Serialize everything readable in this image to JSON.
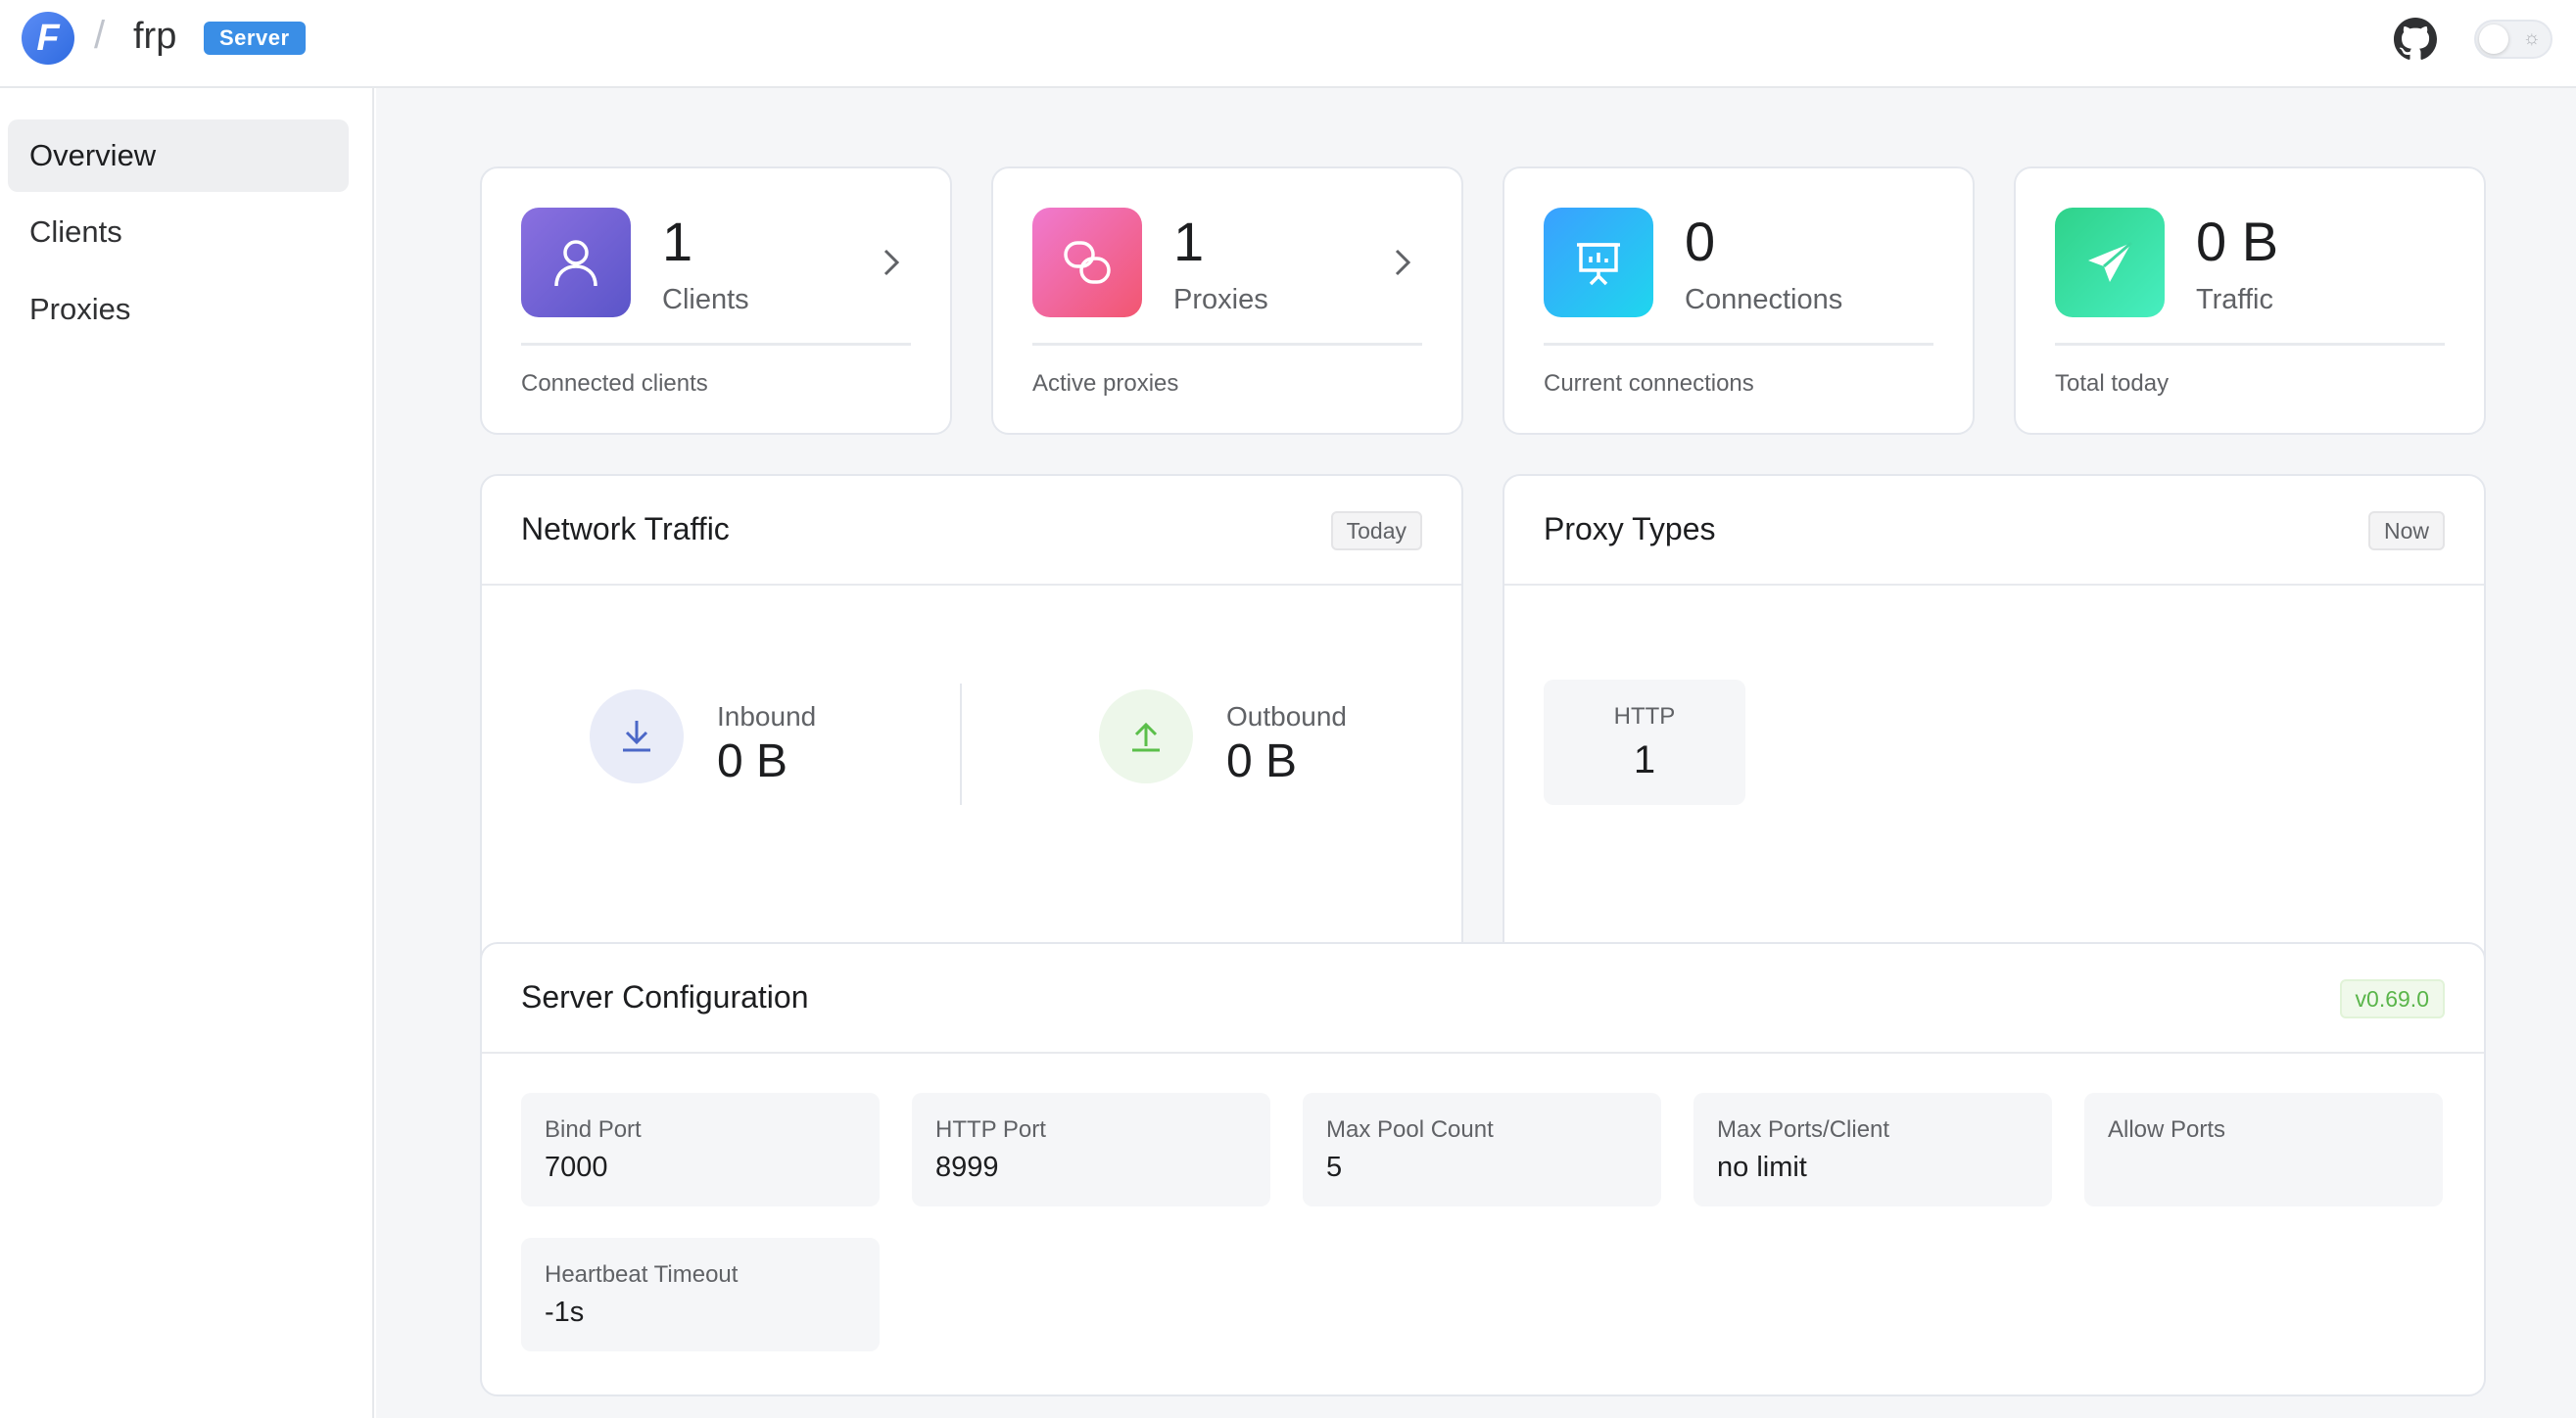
{
  "header": {
    "logo_letter": "F",
    "separator": "/",
    "app_name": "frp",
    "badge": "Server",
    "github_icon": "github-icon",
    "theme_icon": "sun-icon"
  },
  "sidebar": {
    "items": [
      {
        "label": "Overview",
        "active": true
      },
      {
        "label": "Clients",
        "active": false
      },
      {
        "label": "Proxies",
        "active": false
      }
    ]
  },
  "stats": [
    {
      "value": "1",
      "label": "Clients",
      "sub": "Connected clients",
      "icon": "user-icon",
      "color": "#6b5fd6",
      "has_link": true
    },
    {
      "value": "1",
      "label": "Proxies",
      "sub": "Active proxies",
      "icon": "link-icon",
      "color": "#f0609a",
      "has_link": true
    },
    {
      "value": "0",
      "label": "Connections",
      "sub": "Current connections",
      "icon": "presentation-icon",
      "color": "#29b8f7",
      "has_link": false
    },
    {
      "value": "0 B",
      "label": "Traffic",
      "sub": "Total today",
      "icon": "send-icon",
      "color": "#3de0a0",
      "has_link": false
    }
  ],
  "network_traffic": {
    "title": "Network Traffic",
    "tag": "Today",
    "inbound": {
      "label": "Inbound",
      "value": "0 B",
      "icon": "download-icon"
    },
    "outbound": {
      "label": "Outbound",
      "value": "0 B",
      "icon": "upload-icon"
    }
  },
  "proxy_types": {
    "title": "Proxy Types",
    "tag": "Now",
    "items": [
      {
        "name": "HTTP",
        "count": "1"
      }
    ]
  },
  "server_config": {
    "title": "Server Configuration",
    "version": "v0.69.0",
    "items": [
      {
        "label": "Bind Port",
        "value": "7000"
      },
      {
        "label": "HTTP Port",
        "value": "8999"
      },
      {
        "label": "Max Pool Count",
        "value": "5"
      },
      {
        "label": "Max Ports/Client",
        "value": "no limit"
      },
      {
        "label": "Allow Ports",
        "value": ""
      },
      {
        "label": "Heartbeat Timeout",
        "value": "-1s"
      }
    ]
  }
}
